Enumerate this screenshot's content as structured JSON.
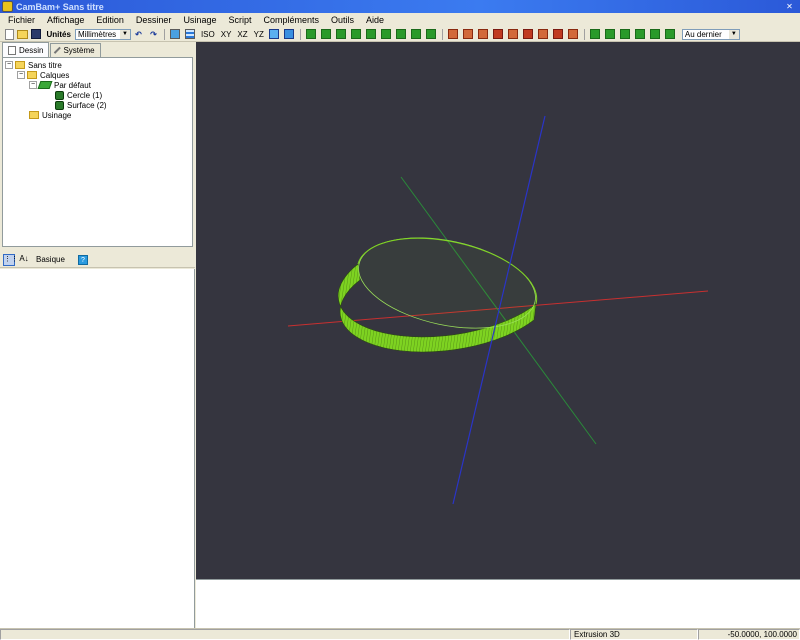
{
  "window": {
    "title": "CamBam+ Sans titre"
  },
  "menu": [
    "Fichier",
    "Affichage",
    "Edition",
    "Dessiner",
    "Usinage",
    "Script",
    "Compléments",
    "Outils",
    "Aide"
  ],
  "toolbar": {
    "units_label": "Unités",
    "units_value": "Millimètres",
    "view_iso": "ISO",
    "view_xy": "XY",
    "view_xz": "XZ",
    "view_yz": "YZ",
    "order_value": "Au dernier"
  },
  "tabs": {
    "drawing": "Dessin",
    "system": "Système"
  },
  "tree": {
    "root": "Sans titre",
    "layers": "Calques",
    "default_layer": "Par défaut",
    "item1": "Cercle (1)",
    "item2": "Surface (2)",
    "machining": "Usinage"
  },
  "properties": {
    "mode_label": "Basique",
    "help": "?"
  },
  "status": {
    "operation": "Extrusion 3D",
    "coordinates": "-50.0000, 100.0000"
  },
  "colors": {
    "viewport_bg": "#35353f",
    "x_axis": "#c83030",
    "y_axis": "#2a8a3a",
    "z_axis": "#2a34c8",
    "ring_fill": "#7ed321",
    "ring_stroke": "#2a4a10"
  }
}
